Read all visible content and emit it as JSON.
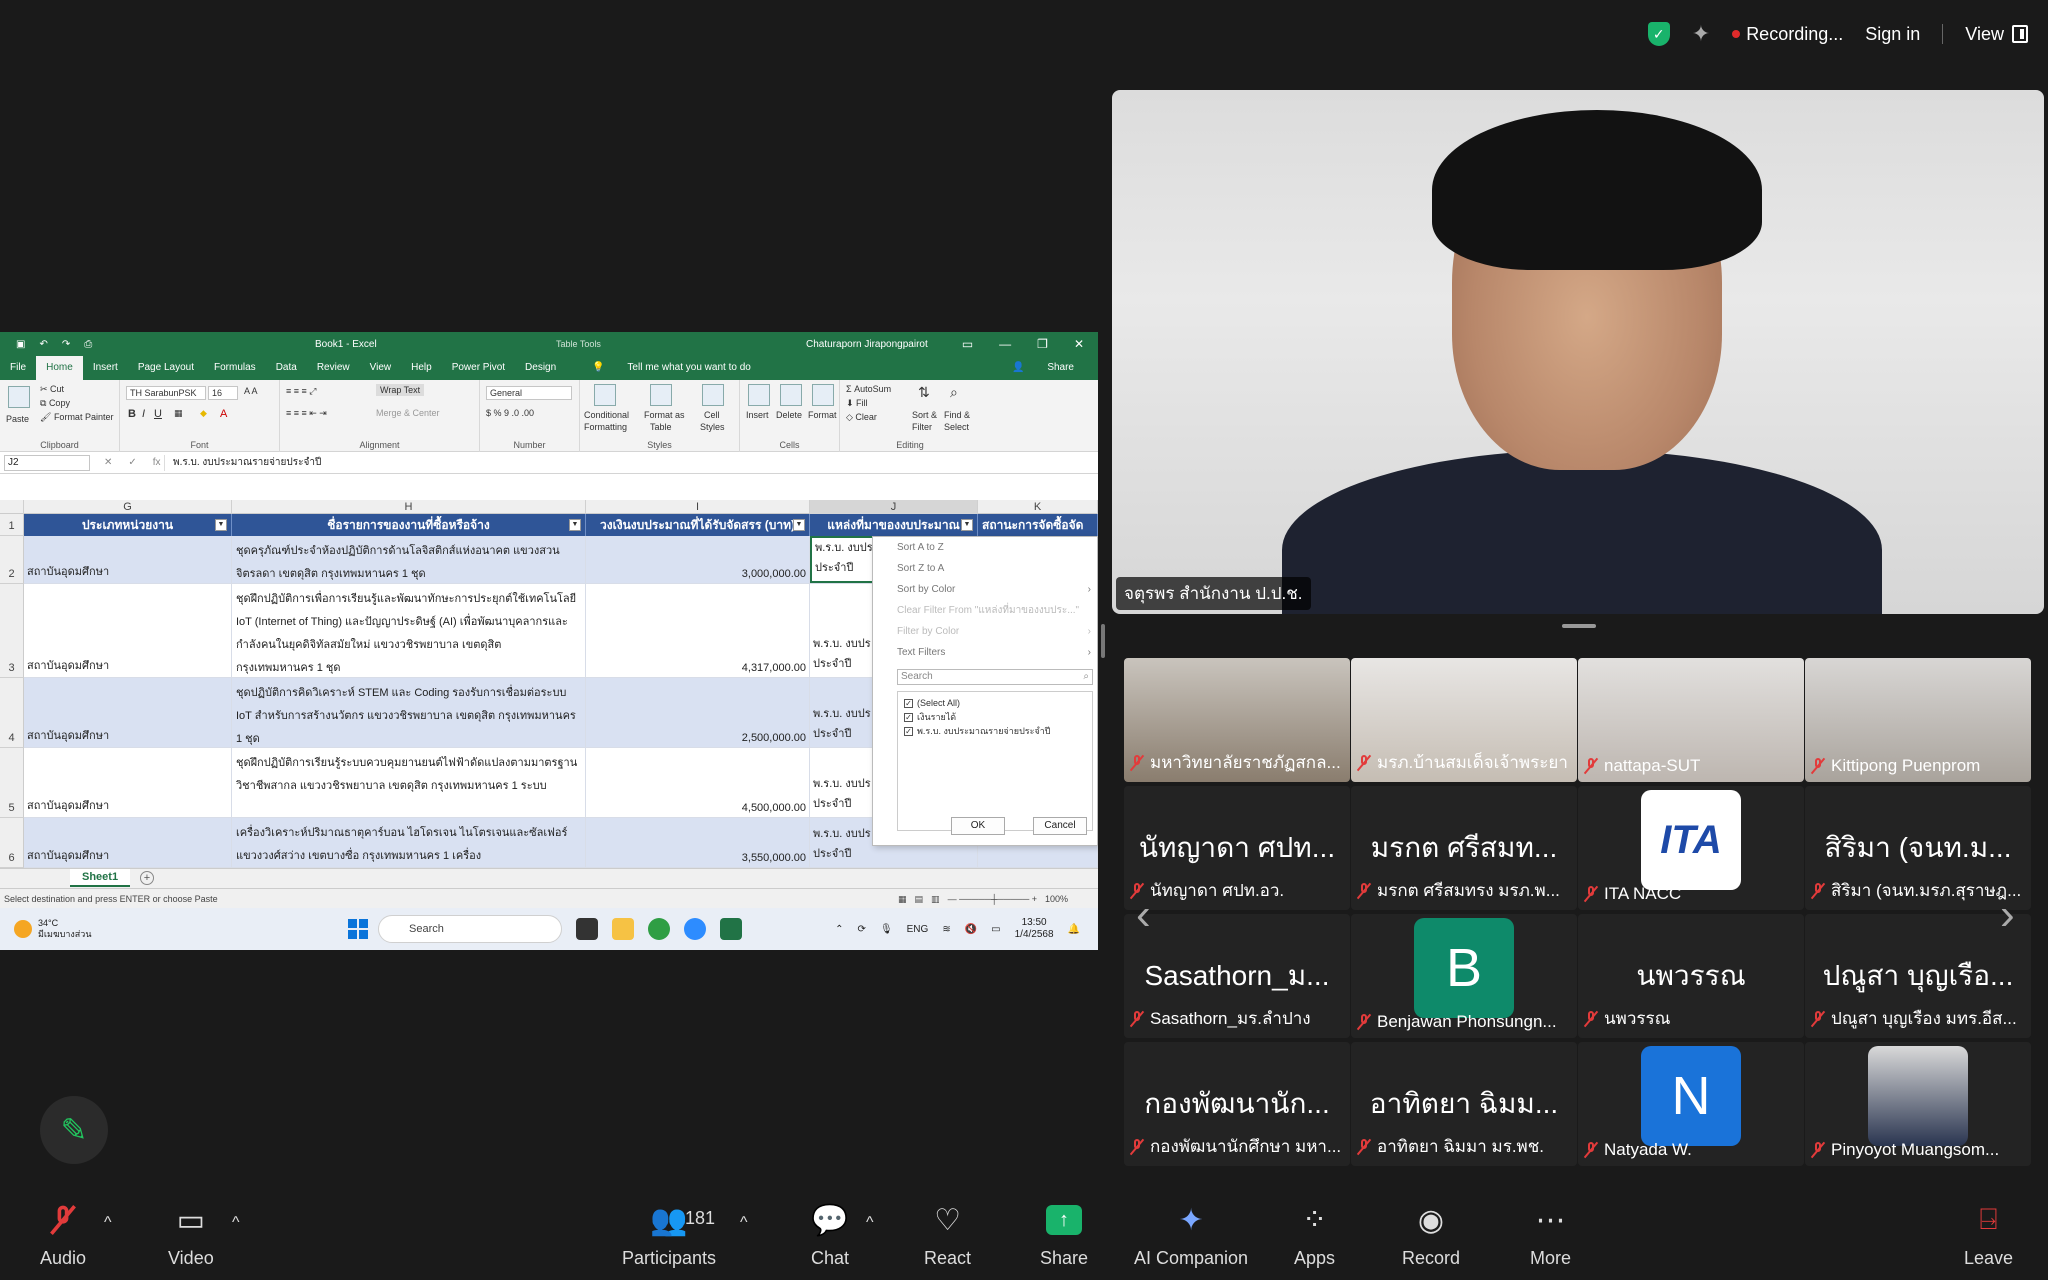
{
  "topbar": {
    "recording": "Recording...",
    "sign_in": "Sign in",
    "view": "View"
  },
  "excel": {
    "title": "Book1 - Excel",
    "table_tools": "Table Tools",
    "user": "Chaturaporn Jirapongpairot",
    "tabs": [
      "File",
      "Home",
      "Insert",
      "Page Layout",
      "Formulas",
      "Data",
      "Review",
      "View",
      "Help",
      "Power Pivot",
      "Design"
    ],
    "tell_me": "Tell me what you want to do",
    "share": "Share",
    "ribbon": {
      "paste": "Paste",
      "cut": "Cut",
      "copy": "Copy",
      "format_painter": "Format Painter",
      "clipboard": "Clipboard",
      "font_name": "TH SarabunPSK",
      "font_size": "16",
      "font": "Font",
      "wrap_text": "Wrap Text",
      "merge_center": "Merge & Center",
      "alignment": "Alignment",
      "number_format": "General",
      "number": "Number",
      "conditional": "Conditional",
      "formatting": "Formatting",
      "format_as": "Format as",
      "table": "Table",
      "cell": "Cell",
      "styles_btn": "Styles",
      "styles": "Styles",
      "insert": "Insert",
      "delete": "Delete",
      "format": "Format",
      "cells": "Cells",
      "autosum": "AutoSum",
      "fill": "Fill",
      "clear": "Clear",
      "sort_filter": "Sort &",
      "filter_sub": "Filter",
      "find_select": "Find &",
      "select_sub": "Select",
      "editing": "Editing"
    },
    "name_box": "J2",
    "formula": "พ.ร.บ. งบประมาณรายจ่ายประจำปี",
    "columns": [
      "G",
      "H",
      "I",
      "J",
      "K"
    ],
    "headers": [
      "ประเภทหน่วยงาน",
      "ชื่อรายการของงานที่ซื้อหรือจ้าง",
      "วงเงินงบประมาณที่ได้รับจัดสรร (บาท)",
      "แหล่งที่มาของงบประมาณ",
      "สถานะการจัดซื้อจัด"
    ],
    "rows": [
      {
        "num": "2",
        "g": "สถาบันอุดมศึกษา",
        "h": "ชุดครุภัณฑ์ประจำห้องปฏิบัติการด้านโลจิสติกส์แห่งอนาคต แขวงสวนจิตรลดา เขตดุสิต กรุงเทพมหานคร 1 ชุด",
        "i": "3,000,000.00",
        "j1": "พ.ร.บ. งบปร",
        "j2": "ประจำปี"
      },
      {
        "num": "3",
        "g": "สถาบันอุดมศึกษา",
        "h": "ชุดฝึกปฏิบัติการเพื่อการเรียนรู้และพัฒนาทักษะการประยุกต์ใช้เทคโนโลยี IoT (Internet of Thing) และปัญญาประดิษฐ์ (AI) เพื่อพัฒนาบุคลากรและกำลังคนในยุคดิจิทัลสมัยใหม่ แขวงวชิรพยาบาล เขตดุสิต กรุงเทพมหานคร 1 ชุด",
        "i": "4,317,000.00",
        "j1": "พ.ร.บ. งบปร",
        "j2": "ประจำปี"
      },
      {
        "num": "4",
        "g": "สถาบันอุดมศึกษา",
        "h": "ชุดปฏิบัติการคิดวิเคราะห์ STEM และ Coding รองรับการเชื่อมต่อระบบ IoT สำหรับการสร้างนวัตกร แขวงวชิรพยาบาล เขตดุสิต กรุงเทพมหานคร 1 ชุด",
        "i": "2,500,000.00",
        "j1": "พ.ร.บ. งบปร",
        "j2": "ประจำปี"
      },
      {
        "num": "5",
        "g": "สถาบันอุดมศึกษา",
        "h": "ชุดฝึกปฏิบัติการเรียนรู้ระบบควบคุมยานยนต์ไฟฟ้าดัดแปลงตามมาตรฐานวิชาชีพสากล แขวงวชิรพยาบาล เขตดุสิต กรุงเทพมหานคร 1 ระบบ",
        "i": "4,500,000.00",
        "j1": "พ.ร.บ. งบปร",
        "j2": "ประจำปี"
      },
      {
        "num": "6",
        "g": "สถาบันอุดมศึกษา",
        "h": "เครื่องวิเคราะห์ปริมาณธาตุคาร์บอน ไฮโดรเจน ไนโตรเจนและซัลเฟอร์ แขวงวงศ์สว่าง เขตบางซื่อ กรุงเทพมหานคร 1 เครื่อง",
        "i": "3,550,000.00",
        "j1": "พ.ร.บ. งบปร",
        "j2": "ประจำปี"
      }
    ],
    "sheet": "Sheet1",
    "status": "Select destination and press ENTER or choose Paste",
    "zoom": "100%",
    "filter_menu": {
      "sort_az": "Sort A to Z",
      "sort_za": "Sort Z to A",
      "sort_color": "Sort by Color",
      "clear_filter": "Clear Filter From \"แหล่งที่มาของงบประ...\"",
      "filter_color": "Filter by Color",
      "text_filters": "Text Filters",
      "search": "Search",
      "items": [
        "(Select All)",
        "เงินรายได้",
        "พ.ร.บ. งบประมาณรายจ่ายประจำปี"
      ],
      "ok": "OK",
      "cancel": "Cancel"
    }
  },
  "taskbar": {
    "temp": "34°C",
    "weather": "มีเมฆบางส่วน",
    "search": "Search",
    "lang": "ENG",
    "time": "13:50",
    "date": "1/4/2568"
  },
  "speaker": {
    "name": "จตุรพร สำนักงาน ป.ป.ช."
  },
  "gallery": [
    {
      "name": "มหาวิทยาลัยราชภัฏสกล...",
      "type": "video",
      "muted": true
    },
    {
      "name": "มรภ.บ้านสมเด็จเจ้าพระยา",
      "type": "video",
      "muted": true
    },
    {
      "name": "nattapa-SUT",
      "type": "video",
      "muted": true
    },
    {
      "name": "Kittipong Puenprom",
      "type": "video",
      "muted": true
    },
    {
      "big": "นัทญาดา ศปท...",
      "name": "นัทญาดา ศปท.อว.",
      "type": "text",
      "muted": true
    },
    {
      "big": "มรกต ศรีสมท...",
      "name": "มรกต ศรีสมทรง มรภ.พ...",
      "type": "text",
      "muted": true
    },
    {
      "logo": "ITA",
      "name": "ITA NACC",
      "type": "logo",
      "muted": true
    },
    {
      "big": "สิริมา (จนท.ม...",
      "name": "สิริมา (จนท.มรภ.สุราษฎ...",
      "type": "text",
      "muted": true
    },
    {
      "big": "Sasathorn_ม...",
      "name": "Sasathorn_มร.ลำปาง",
      "type": "text",
      "muted": true
    },
    {
      "initial": "B",
      "name": "Benjawan Phonsungn...",
      "type": "avatar",
      "color": "#0e8a6a",
      "muted": true
    },
    {
      "big": "นพวรรณ",
      "name": "นพวรรณ",
      "type": "text",
      "muted": true
    },
    {
      "big": "ปณูสา บุญเรือ...",
      "name": "ปณูสา บุญเรือง มทร.อีส...",
      "type": "text",
      "muted": true
    },
    {
      "big": "กองพัฒนานัก...",
      "name": "กองพัฒนานักศึกษา มหา...",
      "type": "text",
      "muted": true
    },
    {
      "big": "อาทิตยา ฉิมม...",
      "name": "อาทิตยา ฉิมมา มร.พช.",
      "type": "text",
      "muted": true
    },
    {
      "initial": "N",
      "name": "Natyada W.",
      "type": "avatar",
      "color": "#1a73d9",
      "muted": true
    },
    {
      "name": "Pinyoyot Muangsom...",
      "type": "photo",
      "muted": true
    }
  ],
  "toolbar": {
    "audio": "Audio",
    "video": "Video",
    "participants": "Participants",
    "participants_count": "181",
    "chat": "Chat",
    "react": "React",
    "share": "Share",
    "ai_companion": "AI Companion",
    "apps": "Apps",
    "record": "Record",
    "more": "More",
    "leave": "Leave"
  },
  "colors": {
    "excel_green": "#217346",
    "table_header": "#2f5597",
    "band": "#d9e1f2",
    "share_green": "#19b36b",
    "recording_red": "#e02b2b"
  }
}
